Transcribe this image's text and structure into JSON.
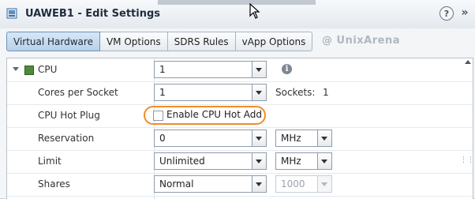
{
  "window": {
    "title": "UAWEB1 - Edit Settings",
    "help_glyph": "?",
    "expand_glyph": "»"
  },
  "tabs": [
    {
      "label": "Virtual Hardware",
      "active": true
    },
    {
      "label": "VM Options",
      "active": false
    },
    {
      "label": "SDRS Rules",
      "active": false
    },
    {
      "label": "vApp Options",
      "active": false
    }
  ],
  "watermark": "@ UnixArena",
  "rows": {
    "cpu": {
      "label": "CPU",
      "value": "1",
      "info_glyph": "i"
    },
    "cores": {
      "label": "Cores per Socket",
      "value": "1",
      "sockets_label": "Sockets:",
      "sockets_value": "1"
    },
    "hotplug": {
      "label": "CPU Hot Plug",
      "checkbox_label": "Enable CPU Hot Add",
      "checked": false
    },
    "reservation": {
      "label": "Reservation",
      "value": "0",
      "unit": "MHz"
    },
    "limit": {
      "label": "Limit",
      "value": "Unlimited",
      "unit": "MHz"
    },
    "shares": {
      "label": "Shares",
      "value": "Normal",
      "shares_value": "1000"
    }
  },
  "colors": {
    "highlight": "#f28c28",
    "active_tab": "#b9d1e9"
  }
}
